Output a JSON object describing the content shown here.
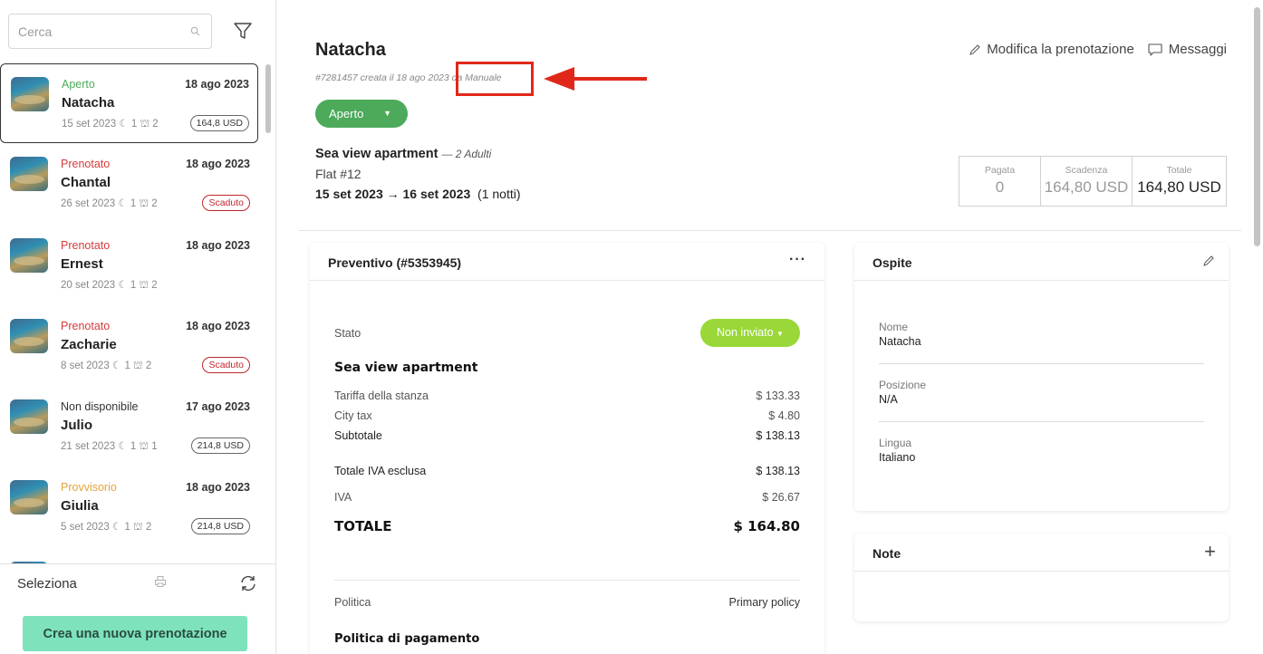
{
  "sidebar": {
    "search_placeholder": "Cerca",
    "reservations": [
      {
        "status": "Aperto",
        "status_color": "#4caa5a",
        "name": "Natacha",
        "booked": "18 ago 2023",
        "checkin": "15 set 2023",
        "nights": "1",
        "guests": "2",
        "badge": "164,8 USD",
        "badge_type": "amount",
        "selected": true
      },
      {
        "status": "Prenotato",
        "status_color": "#d83a3a",
        "name": "Chantal",
        "booked": "18 ago 2023",
        "checkin": "26 set 2023",
        "nights": "1",
        "guests": "2",
        "badge": "Scaduto",
        "badge_type": "expired",
        "selected": false
      },
      {
        "status": "Prenotato",
        "status_color": "#d83a3a",
        "name": "Ernest",
        "booked": "18 ago 2023",
        "checkin": "20 set 2023",
        "nights": "1",
        "guests": "2",
        "badge": "",
        "badge_type": "none",
        "selected": false
      },
      {
        "status": "Prenotato",
        "status_color": "#d83a3a",
        "name": "Zacharie",
        "booked": "18 ago 2023",
        "checkin": "8 set 2023",
        "nights": "1",
        "guests": "2",
        "badge": "Scaduto",
        "badge_type": "expired",
        "selected": false
      },
      {
        "status": "Non disponibile",
        "status_color": "#333333",
        "name": "Julio",
        "booked": "17 ago 2023",
        "checkin": "21 set 2023",
        "nights": "1",
        "guests": "1",
        "badge": "214,8 USD",
        "badge_type": "amount",
        "selected": false
      },
      {
        "status": "Provvisorio",
        "status_color": "#e8a33a",
        "name": "Giulia",
        "booked": "18 ago 2023",
        "checkin": "5 set 2023",
        "nights": "1",
        "guests": "2",
        "badge": "214,8 USD",
        "badge_type": "amount",
        "selected": false
      }
    ],
    "footer": {
      "select_label": "Seleziona",
      "create_button": "Crea una nuova prenotazione"
    }
  },
  "header": {
    "guest_name": "Natacha",
    "reference": "#7281457 creata il 18 ago 2023",
    "source": "da Manuale",
    "status": "Aperto",
    "edit_label": "Modifica la prenotazione",
    "messages_label": "Messaggi"
  },
  "summary": {
    "apartment": "Sea view apartment",
    "guests_text": "— 2 Adulti",
    "flat": "Flat #12",
    "date_from": "15 set 2023",
    "date_to": "16 set 2023",
    "nights_text": "(1 notti)",
    "payment": {
      "paid_label": "Pagata",
      "paid_value": "0",
      "due_label": "Scadenza",
      "due_value": "164,80 USD",
      "total_label": "Totale",
      "total_value": "164,80 USD"
    }
  },
  "quote": {
    "title": "Preventivo (#5353945)",
    "state_label": "Stato",
    "state_value": "Non inviato",
    "apartment": "Sea view apartment",
    "rows": [
      {
        "label": "Tariffa della stanza",
        "value": "$ 133.33"
      },
      {
        "label": "City tax",
        "value": "$ 4.80"
      },
      {
        "label": "Subtotale",
        "value": "$ 138.13"
      },
      {
        "label": "Totale IVA esclusa",
        "value": "$ 138.13"
      },
      {
        "label": "IVA",
        "value": "$ 26.67"
      }
    ],
    "total_label": "TOTALE",
    "total_value": "$ 164.80",
    "policy_label": "Politica",
    "policy_value": "Primary policy",
    "payment_policy_title": "Politica di pagamento"
  },
  "guest": {
    "title": "Ospite",
    "fields": [
      {
        "label": "Nome",
        "value": "Natacha"
      },
      {
        "label": "Posizione",
        "value": "N/A"
      },
      {
        "label": "Lingua",
        "value": "Italiano"
      }
    ]
  },
  "notes": {
    "title": "Note"
  },
  "colors": {
    "open_green": "#4caa5a",
    "not_sent_green": "#9ad83a",
    "create_button": "#7ee3bd",
    "annotation_red": "#e0281a"
  }
}
